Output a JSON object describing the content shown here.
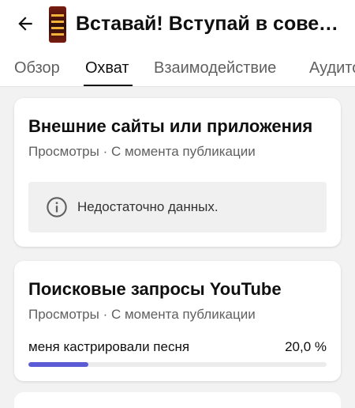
{
  "header": {
    "title": "Вставай! Вступай в советскую армию",
    "back_icon": "arrow-back-icon"
  },
  "tabs": [
    {
      "label": "Обзор",
      "active": false
    },
    {
      "label": "Охват",
      "active": true
    },
    {
      "label": "Взаимодействие",
      "active": false
    },
    {
      "label": "Аудитория",
      "active": false
    }
  ],
  "external_card": {
    "title": "Внешние сайты или приложения",
    "subtitle": "Просмотры · С момента публикации",
    "empty_message": "Недостаточно данных.",
    "info_icon": "info-icon"
  },
  "search_card": {
    "title": "Поисковые запросы YouTube",
    "subtitle": "Просмотры · С момента публикации",
    "queries": [
      {
        "term": "меня кастрировали песня",
        "percent_label": "20,0 %",
        "share": 0.2
      }
    ]
  },
  "colors": {
    "bar_fill": "#5b5bd6",
    "bar_track": "#ececec",
    "text_primary": "#0f0f0f",
    "text_secondary": "#606060"
  }
}
